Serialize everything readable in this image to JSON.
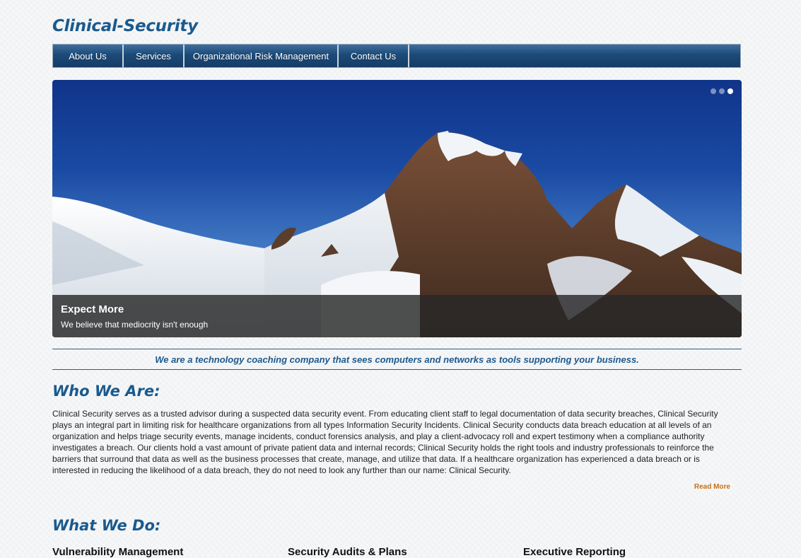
{
  "site": {
    "title": "Clinical-Security"
  },
  "nav": {
    "items": [
      {
        "label": "About Us"
      },
      {
        "label": "Services"
      },
      {
        "label": "Organizational Risk Management"
      },
      {
        "label": "Contact Us"
      }
    ]
  },
  "slider": {
    "caption_title": "Expect More",
    "caption_text": "We believe that mediocrity isn't enough",
    "slide_count": 3,
    "active_slide": 3
  },
  "tagline": "We are a technology coaching company that sees computers and networks as tools supporting your business.",
  "who": {
    "heading": "Who We Are:",
    "body": "Clinical Security serves as a trusted advisor during a suspected data security event. From educating client staff to legal documentation of data security breaches, Clinical Security plays an integral part in limiting risk for healthcare organizations from all types Information Security Incidents. Clinical Security conducts data breach education at all levels of an organization and helps triage security events, manage incidents, conduct forensics analysis, and play a client-advocacy roll and expert testimony when a compliance authority investigates a breach. Our clients hold a vast amount of private patient data and internal records; Clinical Security holds the right tools and industry professionals to reinforce the barriers that surround that data as well as the business processes that create, manage, and utilize that data. If a healthcare organization has experienced a data breach or is interested in reducing the likelihood of a data breach, they do not need to look any further than our name: Clinical Security.",
    "read_more": "Read More"
  },
  "what": {
    "heading": "What We Do:",
    "services": [
      {
        "title": "Vulnerability Management"
      },
      {
        "title": "Security Audits & Plans"
      },
      {
        "title": "Executive Reporting"
      }
    ]
  },
  "colors": {
    "brand_blue": "#1a5a8e",
    "nav_dark": "#153d66",
    "read_more": "#c5721c"
  }
}
